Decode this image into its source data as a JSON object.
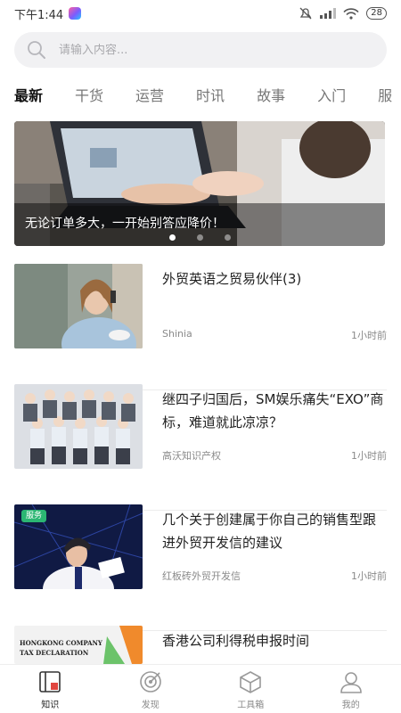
{
  "status_bar": {
    "time": "下午1:44",
    "battery": "28"
  },
  "search": {
    "placeholder": "请输入内容..."
  },
  "tabs": [
    {
      "label": "最新",
      "active": true
    },
    {
      "label": "干货"
    },
    {
      "label": "运营"
    },
    {
      "label": "时讯"
    },
    {
      "label": "故事"
    },
    {
      "label": "入门"
    },
    {
      "label": "服"
    }
  ],
  "banner": {
    "caption": "无论订单多大，一开始别答应降价！",
    "page_count": 3,
    "active_page": 1
  },
  "articles": [
    {
      "title": "外贸英语之贸易伙伴(3)",
      "source": "Shinia",
      "time": "1小时前",
      "tag": ""
    },
    {
      "title": "继四子归国后，SM娱乐痛失“EXO”商标，难道就此凉凉？",
      "source": "高沃知识产权",
      "time": "1小时前",
      "tag": ""
    },
    {
      "title": "几个关于创建属于你自己的销售型跟进外贸开发信的建议",
      "source": "红板砖外贸开发信",
      "time": "1小时前",
      "tag": "服务"
    },
    {
      "title": "香港公司利得税申报时间",
      "source": "",
      "time": "",
      "tag": "",
      "thumb_text": [
        "HONGKONG COMPANY",
        "TAX DECLARATION"
      ]
    }
  ],
  "bottom_nav": [
    {
      "label": "知识",
      "icon": "knowledge-icon",
      "active": true
    },
    {
      "label": "发现",
      "icon": "discover-icon"
    },
    {
      "label": "工具箱",
      "icon": "toolbox-icon"
    },
    {
      "label": "我的",
      "icon": "profile-icon"
    }
  ],
  "colors": {
    "accent": "#e0453f",
    "tag_green": "#2bb673"
  }
}
